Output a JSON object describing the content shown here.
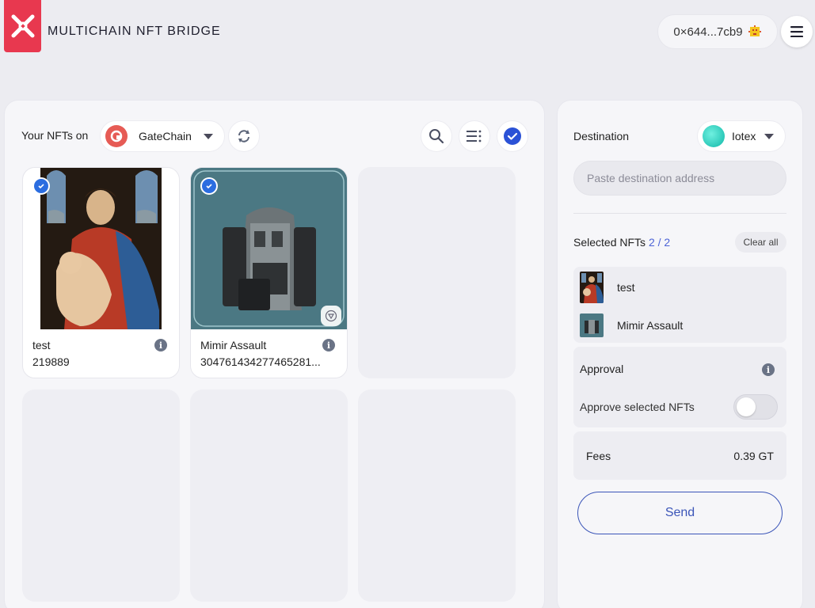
{
  "header": {
    "brand": "MULTICHAIN NFT BRIDGE",
    "wallet_address": "0×644...7cb9",
    "accent_color": "#e8384f"
  },
  "main": {
    "your_nfts_label": "Your NFTs on",
    "source_chain": "GateChain",
    "nfts": [
      {
        "name": "test",
        "id": "219889",
        "selected": true
      },
      {
        "name": "Mimir Assault",
        "id": "304761434277465281...",
        "selected": true
      }
    ]
  },
  "side": {
    "destination_label": "Destination",
    "destination_chain": "Iotex",
    "address_placeholder": "Paste destination address",
    "selected_label": "Selected NFTs",
    "selected_count": "2 / 2",
    "clear_all": "Clear all",
    "selected_items": [
      "test",
      "Mimir Assault"
    ],
    "approval_title": "Approval",
    "approve_label": "Approve selected NFTs",
    "approve_enabled": false,
    "fees_label": "Fees",
    "fees_value": "0.39 GT",
    "send_label": "Send"
  }
}
